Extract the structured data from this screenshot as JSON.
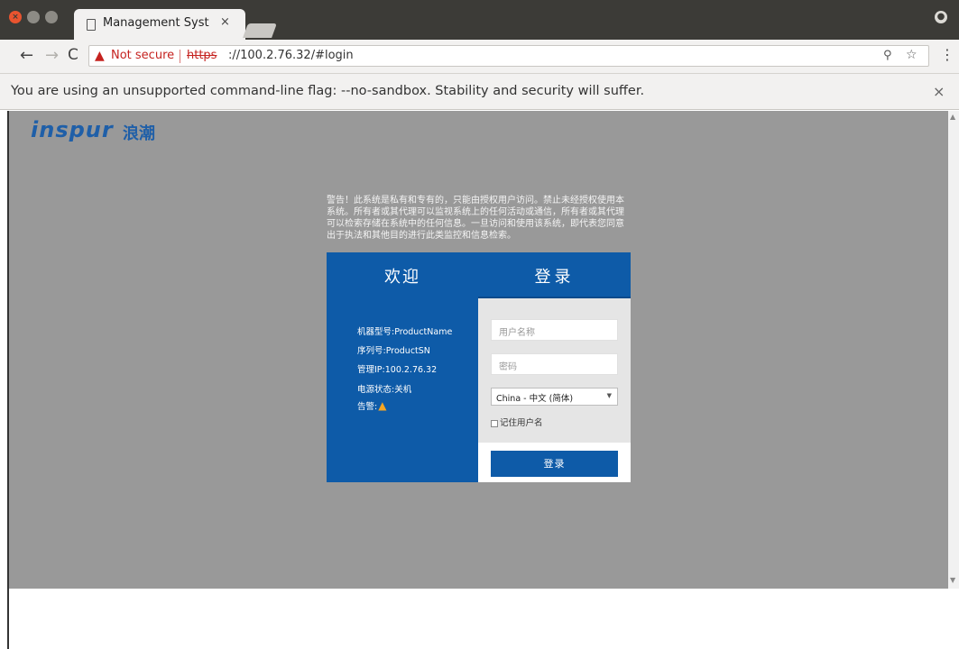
{
  "browser": {
    "tab_title": "Management Syste",
    "tab_close": "×",
    "security_label": "Not secure",
    "url_scheme": "https",
    "url_rest": "://100.2.76.32/#login",
    "infobar_text": "You are using an unsupported command-line flag: --no-sandbox. Stability and security will suffer.",
    "infobar_close": "×",
    "icons": [
      "close-icon",
      "minimize-icon",
      "maximize-icon",
      "page-icon",
      "profile-icon",
      "back-icon",
      "forward-icon",
      "reload-icon",
      "warning-icon",
      "zoom-icon",
      "star-icon",
      "menu-icon"
    ]
  },
  "page": {
    "logo": "inspur",
    "logo_cn": "浪潮",
    "warning_text": "警告！此系统是私有和专有的，只能由授权用户访问。禁止未经授权使用本系统。所有者或其代理可以监视系统上的任何活动或通信，所有者或其代理可以检索存储在系统中的任何信息。一旦访问和使用该系统，即代表您同意出于执法和其他目的进行此类监控和信息检索。",
    "header": {
      "welcome": "欢迎",
      "login": "登录"
    },
    "info": {
      "product_name": "机器型号:ProductName",
      "product_sn": "序列号:ProductSN",
      "management_ip": "管理IP:100.2.76.32",
      "power_status": "电源状态:关机",
      "alarm_label": "告警:"
    },
    "form": {
      "username_placeholder": "用户名称",
      "password_placeholder": "密码",
      "language_selected": "China - 中文 (简体)",
      "remember_label": "记住用户名",
      "login_button": "登录"
    },
    "colors": {
      "primary": "#0e5ba8",
      "background": "#999999",
      "alarm": "#f5a623"
    }
  }
}
